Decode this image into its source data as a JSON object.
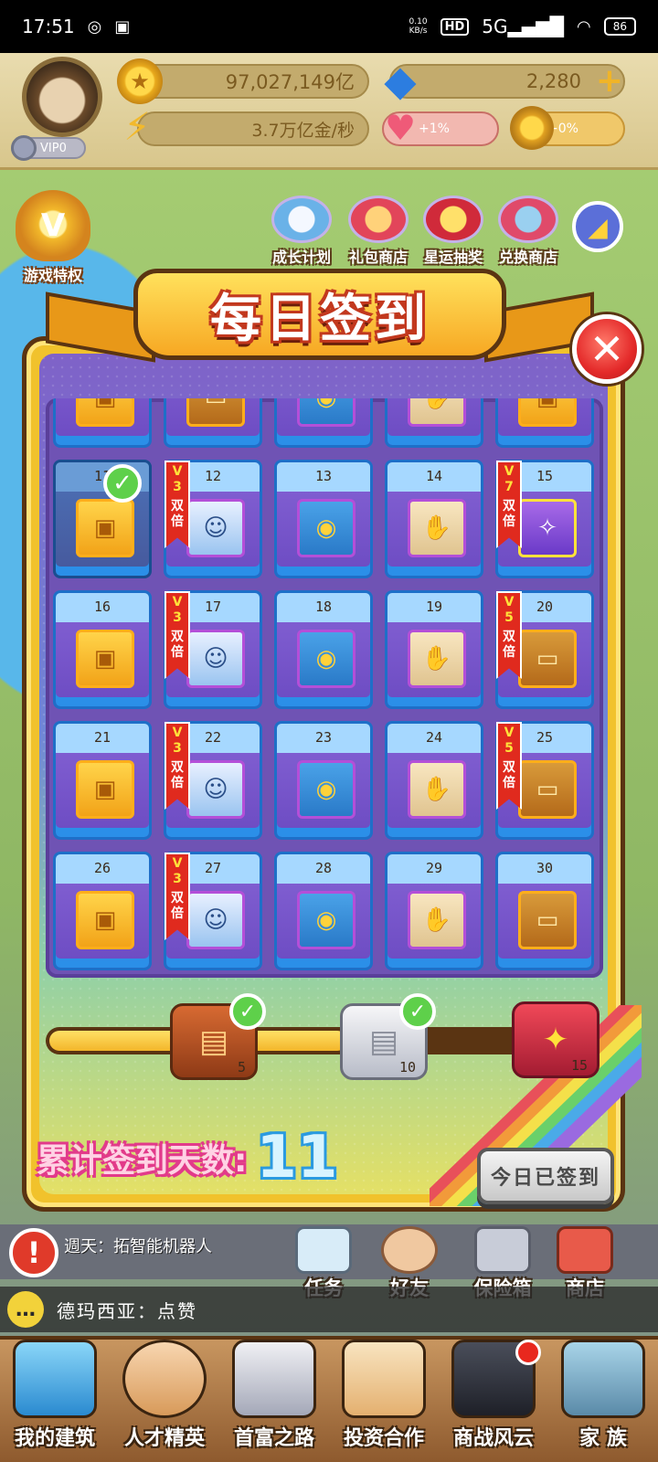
{
  "status_bar": {
    "time": "17:51",
    "net_speed_value": "0.10",
    "net_speed_unit": "KB/s",
    "hd": "HD",
    "signal": "5G",
    "battery": "86"
  },
  "header": {
    "vip_label": "VIP0",
    "coins": "97,027,149亿",
    "gems": "2,280",
    "income_rate": "3.7万亿金/秒",
    "heart_bonus": "+1%",
    "coin_bonus": "+0%"
  },
  "features": {
    "vip_privilege": "游戏特权",
    "growth_plan": "成长计划",
    "gift_shop": "礼包商店",
    "lucky_draw": "星运抽奖",
    "exchange_shop": "兑换商店"
  },
  "dialog": {
    "title": "每日签到",
    "cumulative_label": "累计签到天数:",
    "cumulative_value": "11",
    "signed_button": "今日已签到",
    "double_label": "双倍",
    "partial_row": [
      {
        "reward": "chest"
      },
      {
        "reward": "card"
      },
      {
        "reward": "coin"
      },
      {
        "reward": "hand"
      },
      {
        "reward": "chest"
      }
    ],
    "days": [
      {
        "day": "11",
        "reward": "chest",
        "signed": true
      },
      {
        "day": "12",
        "reward": "worker",
        "vip": "3"
      },
      {
        "day": "13",
        "reward": "coin"
      },
      {
        "day": "14",
        "reward": "hand"
      },
      {
        "day": "15",
        "reward": "special",
        "vip": "7"
      },
      {
        "day": "16",
        "reward": "chest"
      },
      {
        "day": "17",
        "reward": "worker",
        "vip": "3"
      },
      {
        "day": "18",
        "reward": "coin"
      },
      {
        "day": "19",
        "reward": "hand"
      },
      {
        "day": "20",
        "reward": "card",
        "vip": "5"
      },
      {
        "day": "21",
        "reward": "chest"
      },
      {
        "day": "22",
        "reward": "worker",
        "vip": "3"
      },
      {
        "day": "23",
        "reward": "coin"
      },
      {
        "day": "24",
        "reward": "hand"
      },
      {
        "day": "25",
        "reward": "card",
        "vip": "5"
      },
      {
        "day": "26",
        "reward": "chest"
      },
      {
        "day": "27",
        "reward": "worker",
        "vip": "3"
      },
      {
        "day": "28",
        "reward": "coin"
      },
      {
        "day": "29",
        "reward": "hand"
      },
      {
        "day": "30",
        "reward": "card"
      }
    ],
    "progress_fraction": 0.55,
    "milestones": [
      {
        "days": "5",
        "reached": true
      },
      {
        "days": "10",
        "reached": true
      },
      {
        "days": "15",
        "reached": false
      }
    ]
  },
  "hud": {
    "notice": "週天：拓智能机器人",
    "task": "任务",
    "friends": "好友",
    "vault": "保险箱",
    "shop": "商店"
  },
  "chat": {
    "message": "德玛西亚：点赞"
  },
  "bottom_nav": [
    {
      "label": "我的建筑"
    },
    {
      "label": "人才精英"
    },
    {
      "label": "首富之路"
    },
    {
      "label": "投资合作"
    },
    {
      "label": "商战风云",
      "badge": true
    },
    {
      "label": "家 族"
    }
  ],
  "colors": {
    "dialog_gold": "#f1c22c",
    "grid_purple": "#6f53b4",
    "vip_tag_red": "#e02a1e",
    "check_green": "#5ed04a",
    "close_red": "#e42a2a"
  },
  "icons": {
    "chest": "chest-icon",
    "worker": "worker-icon",
    "coin": "coin-card-icon",
    "hand": "hand-card-icon",
    "card": "vehicle-card-icon",
    "special": "rare-talent-icon"
  }
}
